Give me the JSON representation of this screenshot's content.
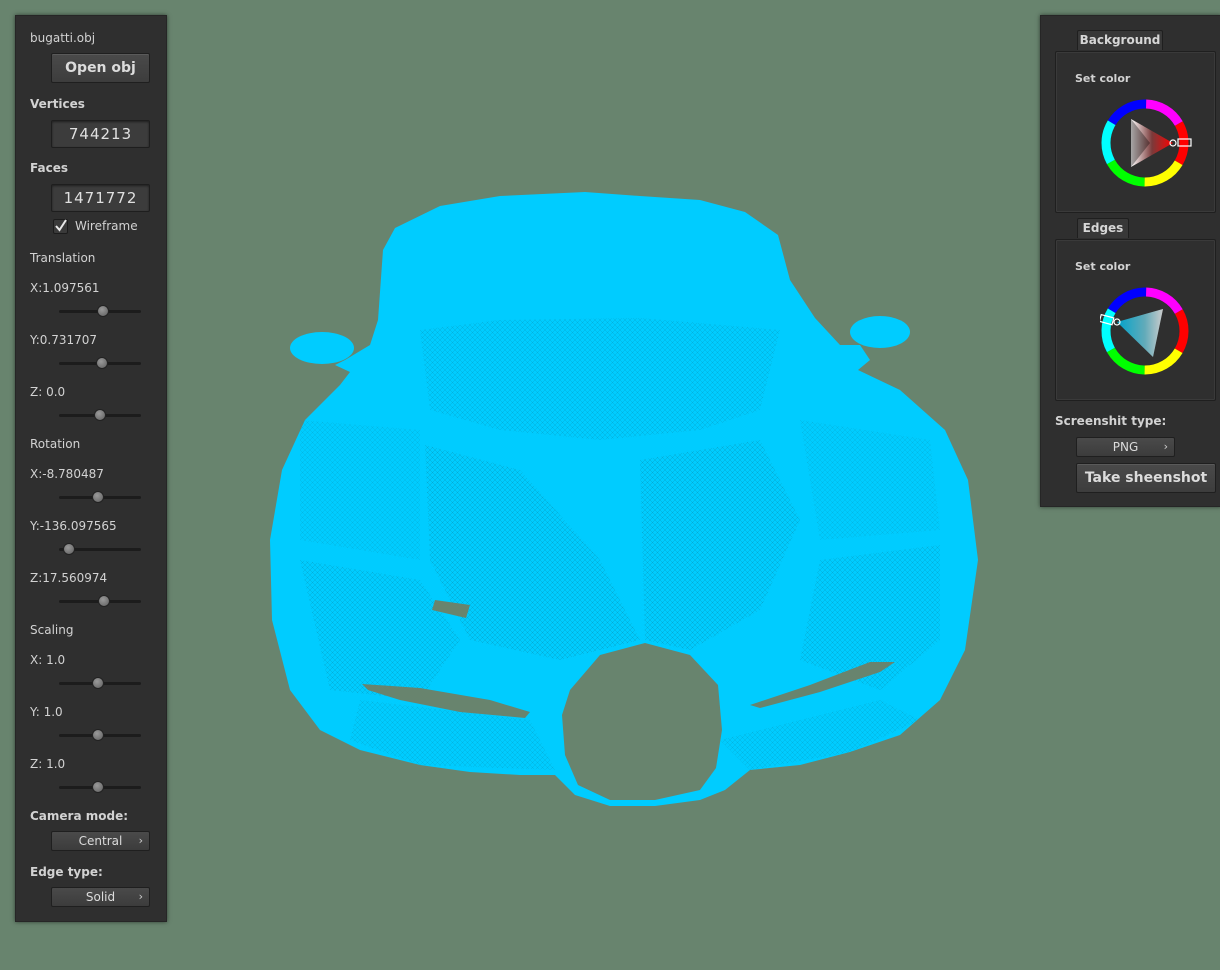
{
  "left_panel": {
    "file_name": "bugatti.obj",
    "open_button": "Open obj",
    "vertices_label": "Vertices",
    "vertices_value": "744213",
    "faces_label": "Faces",
    "faces_value": "1471772",
    "wireframe_label": "Wireframe",
    "wireframe_checked": true,
    "translation": {
      "title": "Translation",
      "x_label": "X:1.097561",
      "y_label": "Y:0.731707",
      "z_label": "Z: 0.0"
    },
    "rotation": {
      "title": "Rotation",
      "x_label": "X:-8.780487",
      "y_label": "Y:-136.097565",
      "z_label": "Z:17.560974"
    },
    "scaling": {
      "title": "Scaling",
      "x_label": "X: 1.0",
      "y_label": "Y: 1.0",
      "z_label": "Z: 1.0"
    },
    "camera_mode_label": "Camera mode:",
    "camera_mode_value": "Central",
    "edge_type_label": "Edge type:",
    "edge_type_value": "Solid"
  },
  "right_panel": {
    "background_tab": "Background",
    "background_set_color": "Set color",
    "background_color": "#ff0000",
    "edges_tab": "Edges",
    "edges_set_color": "Set color",
    "edges_color": "#00ccff",
    "screenshot_type_label": "Screenshit type:",
    "screenshot_type_value": "PNG",
    "take_screenshot_button": "Take sheenshot"
  },
  "viewport": {
    "background_color": "#68846e",
    "model_color": "#00ccff",
    "model": "bugatti-wireframe"
  }
}
